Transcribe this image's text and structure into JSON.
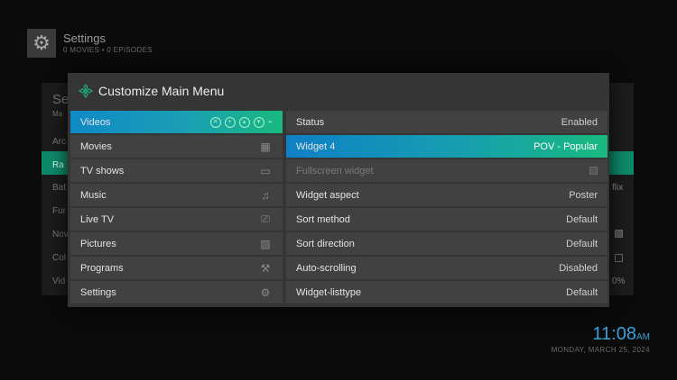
{
  "background": {
    "title": "Settings",
    "subtitle": "0 MOVIES  •  0 EPISODES",
    "left_items": [
      "Se",
      "Ma",
      "Arc",
      "Ra",
      "Bat",
      "Fur",
      "Nov",
      "Col",
      "Vid"
    ],
    "right_items": [
      "flix",
      "",
      "",
      "0%"
    ]
  },
  "clock": {
    "time": "11:08",
    "ampm": "AM",
    "date": "MONDAY, MARCH 25, 2024"
  },
  "dialog": {
    "title": "Customize Main Menu",
    "menu_items": [
      {
        "label": "Videos",
        "icon": "film-icon"
      },
      {
        "label": "Movies",
        "icon": "film-icon"
      },
      {
        "label": "TV shows",
        "icon": "tv-icon"
      },
      {
        "label": "Music",
        "icon": "music-icon"
      },
      {
        "label": "Live TV",
        "icon": "antenna-tv-icon"
      },
      {
        "label": "Pictures",
        "icon": "picture-icon"
      },
      {
        "label": "Programs",
        "icon": "tools-icon"
      },
      {
        "label": "Settings",
        "icon": "gear-icon"
      }
    ],
    "options": [
      {
        "label": "Status",
        "value": "Enabled"
      },
      {
        "label": "Widget 4",
        "value": "POV - Popular"
      },
      {
        "label": "Fullscreen widget",
        "value": ""
      },
      {
        "label": "Widget aspect",
        "value": "Poster"
      },
      {
        "label": "Sort method",
        "value": "Default"
      },
      {
        "label": "Sort direction",
        "value": "Default"
      },
      {
        "label": "Auto-scrolling",
        "value": "Disabled"
      },
      {
        "label": "Widget-listtype",
        "value": "Default"
      }
    ]
  },
  "colors": {
    "accent_blue": "#0f8ac6",
    "accent_green": "#19b97e",
    "clock": "#3aa0d8"
  }
}
